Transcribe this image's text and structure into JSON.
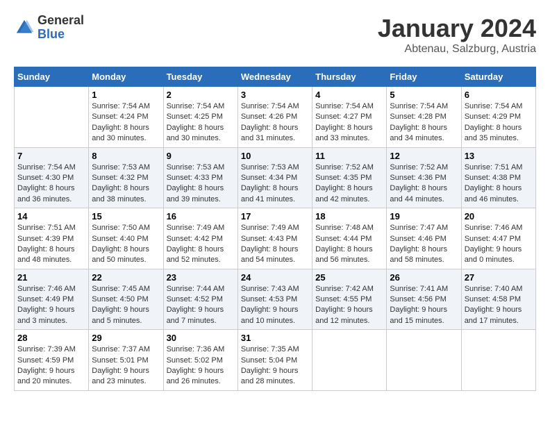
{
  "logo": {
    "general": "General",
    "blue": "Blue"
  },
  "title": "January 2024",
  "location": "Abtenau, Salzburg, Austria",
  "weekdays": [
    "Sunday",
    "Monday",
    "Tuesday",
    "Wednesday",
    "Thursday",
    "Friday",
    "Saturday"
  ],
  "weeks": [
    [
      {
        "day": null,
        "sunrise": null,
        "sunset": null,
        "daylight": null
      },
      {
        "day": "1",
        "sunrise": "Sunrise: 7:54 AM",
        "sunset": "Sunset: 4:24 PM",
        "daylight": "Daylight: 8 hours and 30 minutes."
      },
      {
        "day": "2",
        "sunrise": "Sunrise: 7:54 AM",
        "sunset": "Sunset: 4:25 PM",
        "daylight": "Daylight: 8 hours and 30 minutes."
      },
      {
        "day": "3",
        "sunrise": "Sunrise: 7:54 AM",
        "sunset": "Sunset: 4:26 PM",
        "daylight": "Daylight: 8 hours and 31 minutes."
      },
      {
        "day": "4",
        "sunrise": "Sunrise: 7:54 AM",
        "sunset": "Sunset: 4:27 PM",
        "daylight": "Daylight: 8 hours and 33 minutes."
      },
      {
        "day": "5",
        "sunrise": "Sunrise: 7:54 AM",
        "sunset": "Sunset: 4:28 PM",
        "daylight": "Daylight: 8 hours and 34 minutes."
      },
      {
        "day": "6",
        "sunrise": "Sunrise: 7:54 AM",
        "sunset": "Sunset: 4:29 PM",
        "daylight": "Daylight: 8 hours and 35 minutes."
      }
    ],
    [
      {
        "day": "7",
        "sunrise": "Sunrise: 7:54 AM",
        "sunset": "Sunset: 4:30 PM",
        "daylight": "Daylight: 8 hours and 36 minutes."
      },
      {
        "day": "8",
        "sunrise": "Sunrise: 7:53 AM",
        "sunset": "Sunset: 4:32 PM",
        "daylight": "Daylight: 8 hours and 38 minutes."
      },
      {
        "day": "9",
        "sunrise": "Sunrise: 7:53 AM",
        "sunset": "Sunset: 4:33 PM",
        "daylight": "Daylight: 8 hours and 39 minutes."
      },
      {
        "day": "10",
        "sunrise": "Sunrise: 7:53 AM",
        "sunset": "Sunset: 4:34 PM",
        "daylight": "Daylight: 8 hours and 41 minutes."
      },
      {
        "day": "11",
        "sunrise": "Sunrise: 7:52 AM",
        "sunset": "Sunset: 4:35 PM",
        "daylight": "Daylight: 8 hours and 42 minutes."
      },
      {
        "day": "12",
        "sunrise": "Sunrise: 7:52 AM",
        "sunset": "Sunset: 4:36 PM",
        "daylight": "Daylight: 8 hours and 44 minutes."
      },
      {
        "day": "13",
        "sunrise": "Sunrise: 7:51 AM",
        "sunset": "Sunset: 4:38 PM",
        "daylight": "Daylight: 8 hours and 46 minutes."
      }
    ],
    [
      {
        "day": "14",
        "sunrise": "Sunrise: 7:51 AM",
        "sunset": "Sunset: 4:39 PM",
        "daylight": "Daylight: 8 hours and 48 minutes."
      },
      {
        "day": "15",
        "sunrise": "Sunrise: 7:50 AM",
        "sunset": "Sunset: 4:40 PM",
        "daylight": "Daylight: 8 hours and 50 minutes."
      },
      {
        "day": "16",
        "sunrise": "Sunrise: 7:49 AM",
        "sunset": "Sunset: 4:42 PM",
        "daylight": "Daylight: 8 hours and 52 minutes."
      },
      {
        "day": "17",
        "sunrise": "Sunrise: 7:49 AM",
        "sunset": "Sunset: 4:43 PM",
        "daylight": "Daylight: 8 hours and 54 minutes."
      },
      {
        "day": "18",
        "sunrise": "Sunrise: 7:48 AM",
        "sunset": "Sunset: 4:44 PM",
        "daylight": "Daylight: 8 hours and 56 minutes."
      },
      {
        "day": "19",
        "sunrise": "Sunrise: 7:47 AM",
        "sunset": "Sunset: 4:46 PM",
        "daylight": "Daylight: 8 hours and 58 minutes."
      },
      {
        "day": "20",
        "sunrise": "Sunrise: 7:46 AM",
        "sunset": "Sunset: 4:47 PM",
        "daylight": "Daylight: 9 hours and 0 minutes."
      }
    ],
    [
      {
        "day": "21",
        "sunrise": "Sunrise: 7:46 AM",
        "sunset": "Sunset: 4:49 PM",
        "daylight": "Daylight: 9 hours and 3 minutes."
      },
      {
        "day": "22",
        "sunrise": "Sunrise: 7:45 AM",
        "sunset": "Sunset: 4:50 PM",
        "daylight": "Daylight: 9 hours and 5 minutes."
      },
      {
        "day": "23",
        "sunrise": "Sunrise: 7:44 AM",
        "sunset": "Sunset: 4:52 PM",
        "daylight": "Daylight: 9 hours and 7 minutes."
      },
      {
        "day": "24",
        "sunrise": "Sunrise: 7:43 AM",
        "sunset": "Sunset: 4:53 PM",
        "daylight": "Daylight: 9 hours and 10 minutes."
      },
      {
        "day": "25",
        "sunrise": "Sunrise: 7:42 AM",
        "sunset": "Sunset: 4:55 PM",
        "daylight": "Daylight: 9 hours and 12 minutes."
      },
      {
        "day": "26",
        "sunrise": "Sunrise: 7:41 AM",
        "sunset": "Sunset: 4:56 PM",
        "daylight": "Daylight: 9 hours and 15 minutes."
      },
      {
        "day": "27",
        "sunrise": "Sunrise: 7:40 AM",
        "sunset": "Sunset: 4:58 PM",
        "daylight": "Daylight: 9 hours and 17 minutes."
      }
    ],
    [
      {
        "day": "28",
        "sunrise": "Sunrise: 7:39 AM",
        "sunset": "Sunset: 4:59 PM",
        "daylight": "Daylight: 9 hours and 20 minutes."
      },
      {
        "day": "29",
        "sunrise": "Sunrise: 7:37 AM",
        "sunset": "Sunset: 5:01 PM",
        "daylight": "Daylight: 9 hours and 23 minutes."
      },
      {
        "day": "30",
        "sunrise": "Sunrise: 7:36 AM",
        "sunset": "Sunset: 5:02 PM",
        "daylight": "Daylight: 9 hours and 26 minutes."
      },
      {
        "day": "31",
        "sunrise": "Sunrise: 7:35 AM",
        "sunset": "Sunset: 5:04 PM",
        "daylight": "Daylight: 9 hours and 28 minutes."
      },
      {
        "day": null,
        "sunrise": null,
        "sunset": null,
        "daylight": null
      },
      {
        "day": null,
        "sunrise": null,
        "sunset": null,
        "daylight": null
      },
      {
        "day": null,
        "sunrise": null,
        "sunset": null,
        "daylight": null
      }
    ]
  ]
}
